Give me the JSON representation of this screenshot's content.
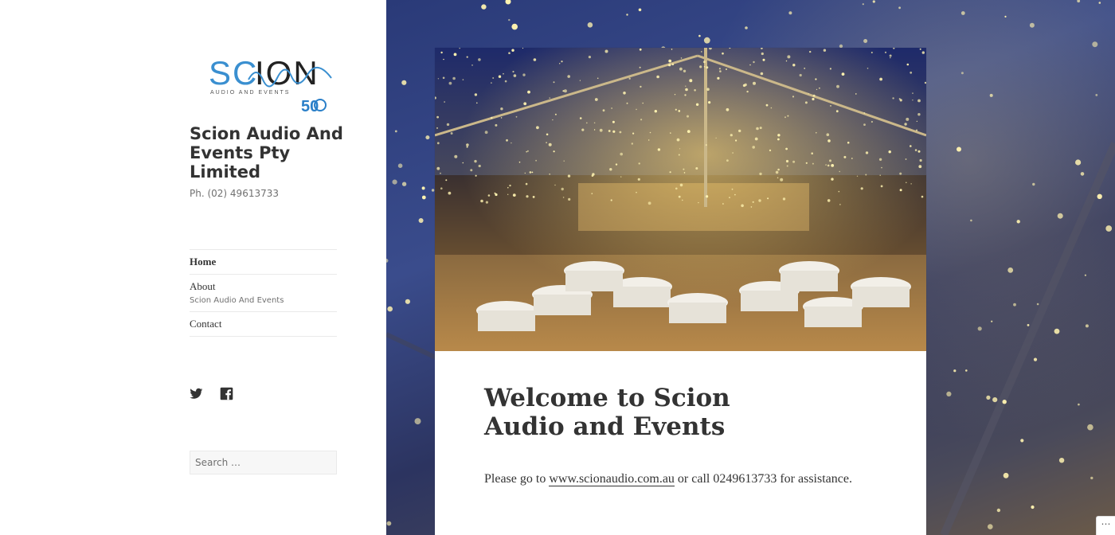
{
  "site": {
    "logo_text": "SCION",
    "logo_subtext": "AUDIO AND EVENTS",
    "logo_badge": "50",
    "title": "Scion Audio And Events Pty Limited",
    "description": "Ph. (02) 49613733"
  },
  "nav": {
    "items": [
      {
        "label": "Home",
        "sub": ""
      },
      {
        "label": "About",
        "sub": "Scion Audio And Events"
      },
      {
        "label": "Contact",
        "sub": ""
      }
    ]
  },
  "social": {
    "icons": [
      "twitter-icon",
      "facebook-icon"
    ]
  },
  "search": {
    "placeholder": "Search …"
  },
  "article": {
    "title": "Welcome to Scion Audio and Events",
    "text_before": "Please go to ",
    "link_text": "www.scionaudio.com.au",
    "text_after": " or call 0249613733 for assistance."
  },
  "colors": {
    "logo_blue": "#3a8fd0",
    "logo_dark": "#222222",
    "sky": "#2a3a78",
    "fairy_light": "#fff3b0"
  }
}
